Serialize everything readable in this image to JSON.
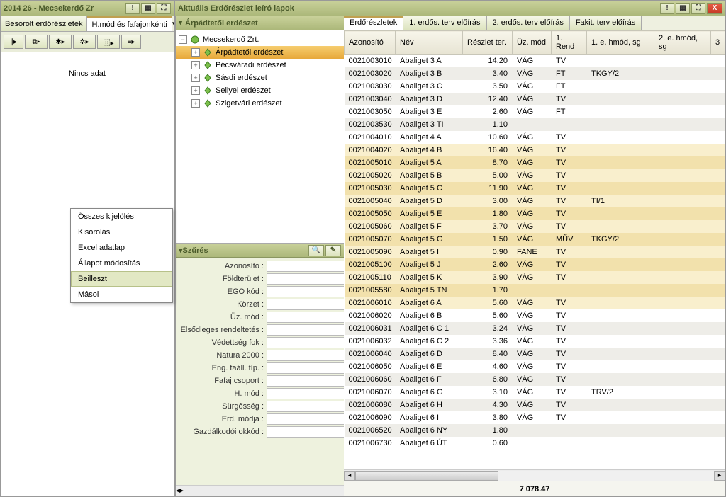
{
  "left": {
    "title": "2014 26 - Mecsekerdő Zr",
    "tabs": [
      "Besorolt erdőrészletek",
      "H.mód és fafajonkénti"
    ],
    "empty_text": "Nincs adat",
    "context_menu": [
      "Összes kijelölés",
      "Kisorolás",
      "Excel adatlap",
      "Állapot módosítás",
      "Beilleszt",
      "Másol"
    ],
    "context_selected": 4
  },
  "mid": {
    "tree_header": "Árpádtetői erdészet",
    "tree_root": "Mecsekerdő Zrt.",
    "tree_children": [
      "Árpádtetői erdészet",
      "Pécsváradi erdészet",
      "Sásdi erdészet",
      "Sellyei erdészet",
      "Szigetvári erdészet"
    ],
    "tree_selected": 0,
    "filter_title": "Szűrés",
    "filter_fields": [
      "Azonosító :",
      "Földterület :",
      "EGO kód :",
      "Körzet :",
      "Üz. mód :",
      "Elsődleges rendeltetés :",
      "Védettség fok :",
      "Natura 2000 :",
      "Eng. faáll. típ. :",
      "Fafaj csoport :",
      "H. mód :",
      "Sürgősség :",
      "Erd. módja :",
      "Gazdálkodói okkód :"
    ]
  },
  "right": {
    "title": "Aktuális Erdőrészlet leíró lapok",
    "tabs": [
      "Erdőrészletek",
      "1. erdős. terv előírás",
      "2. erdős. terv előírás",
      "Fakit. terv előírás"
    ],
    "columns": [
      "Azonosító",
      "Név",
      "Részlet ter.",
      "Üz. mód",
      "1. Rend",
      "1. e. hmód, sg",
      "2. e. hmód, sg",
      "3"
    ],
    "rows": [
      {
        "az": "0021003010",
        "nev": "Abaliget 3 A",
        "ter": "14.20",
        "uz": "VÁG",
        "rend": "TV",
        "h1": "",
        "bg": "white"
      },
      {
        "az": "0021003020",
        "nev": "Abaliget 3 B",
        "ter": "3.40",
        "uz": "VÁG",
        "rend": "FT",
        "h1": "TKGY/2",
        "bg": "gray"
      },
      {
        "az": "0021003030",
        "nev": "Abaliget 3 C",
        "ter": "3.50",
        "uz": "VÁG",
        "rend": "FT",
        "h1": "",
        "bg": "white"
      },
      {
        "az": "0021003040",
        "nev": "Abaliget 3 D",
        "ter": "12.40",
        "uz": "VÁG",
        "rend": "TV",
        "h1": "",
        "bg": "gray"
      },
      {
        "az": "0021003050",
        "nev": "Abaliget 3 E",
        "ter": "2.60",
        "uz": "VÁG",
        "rend": "FT",
        "h1": "",
        "bg": "white"
      },
      {
        "az": "0021003530",
        "nev": "Abaliget 3 TI",
        "ter": "1.10",
        "uz": "",
        "rend": "",
        "h1": "",
        "bg": "gray"
      },
      {
        "az": "0021004010",
        "nev": "Abaliget 4 A",
        "ter": "10.60",
        "uz": "VÁG",
        "rend": "TV",
        "h1": "",
        "bg": "white"
      },
      {
        "az": "0021004020",
        "nev": "Abaliget 4 B",
        "ter": "16.40",
        "uz": "VÁG",
        "rend": "TV",
        "h1": "",
        "bg": "y1"
      },
      {
        "az": "0021005010",
        "nev": "Abaliget 5 A",
        "ter": "8.70",
        "uz": "VÁG",
        "rend": "TV",
        "h1": "",
        "bg": "y2"
      },
      {
        "az": "0021005020",
        "nev": "Abaliget 5 B",
        "ter": "5.00",
        "uz": "VÁG",
        "rend": "TV",
        "h1": "",
        "bg": "y1"
      },
      {
        "az": "0021005030",
        "nev": "Abaliget 5 C",
        "ter": "11.90",
        "uz": "VÁG",
        "rend": "TV",
        "h1": "",
        "bg": "y2"
      },
      {
        "az": "0021005040",
        "nev": "Abaliget 5 D",
        "ter": "3.00",
        "uz": "VÁG",
        "rend": "TV",
        "h1": "TI/1",
        "bg": "y1"
      },
      {
        "az": "0021005050",
        "nev": "Abaliget 5 E",
        "ter": "1.80",
        "uz": "VÁG",
        "rend": "TV",
        "h1": "",
        "bg": "y2"
      },
      {
        "az": "0021005060",
        "nev": "Abaliget 5 F",
        "ter": "3.70",
        "uz": "VÁG",
        "rend": "TV",
        "h1": "",
        "bg": "y1"
      },
      {
        "az": "0021005070",
        "nev": "Abaliget 5 G",
        "ter": "1.50",
        "uz": "VÁG",
        "rend": "MŰV",
        "h1": "TKGY/2",
        "bg": "y2"
      },
      {
        "az": "0021005090",
        "nev": "Abaliget 5 I",
        "ter": "0.90",
        "uz": "FANE",
        "rend": "TV",
        "h1": "",
        "bg": "y1"
      },
      {
        "az": "0021005100",
        "nev": "Abaliget 5 J",
        "ter": "2.60",
        "uz": "VÁG",
        "rend": "TV",
        "h1": "",
        "bg": "y2"
      },
      {
        "az": "0021005110",
        "nev": "Abaliget 5 K",
        "ter": "3.90",
        "uz": "VÁG",
        "rend": "TV",
        "h1": "",
        "bg": "y1"
      },
      {
        "az": "0021005580",
        "nev": "Abaliget 5 TN",
        "ter": "1.70",
        "uz": "",
        "rend": "",
        "h1": "",
        "bg": "y2"
      },
      {
        "az": "0021006010",
        "nev": "Abaliget 6 A",
        "ter": "5.60",
        "uz": "VÁG",
        "rend": "TV",
        "h1": "",
        "bg": "y1"
      },
      {
        "az": "0021006020",
        "nev": "Abaliget 6 B",
        "ter": "5.60",
        "uz": "VÁG",
        "rend": "TV",
        "h1": "",
        "bg": "white"
      },
      {
        "az": "0021006031",
        "nev": "Abaliget 6 C 1",
        "ter": "3.24",
        "uz": "VÁG",
        "rend": "TV",
        "h1": "",
        "bg": "gray"
      },
      {
        "az": "0021006032",
        "nev": "Abaliget 6 C 2",
        "ter": "3.36",
        "uz": "VÁG",
        "rend": "TV",
        "h1": "",
        "bg": "white"
      },
      {
        "az": "0021006040",
        "nev": "Abaliget 6 D",
        "ter": "8.40",
        "uz": "VÁG",
        "rend": "TV",
        "h1": "",
        "bg": "gray"
      },
      {
        "az": "0021006050",
        "nev": "Abaliget 6 E",
        "ter": "4.60",
        "uz": "VÁG",
        "rend": "TV",
        "h1": "",
        "bg": "white"
      },
      {
        "az": "0021006060",
        "nev": "Abaliget 6 F",
        "ter": "6.80",
        "uz": "VÁG",
        "rend": "TV",
        "h1": "",
        "bg": "gray"
      },
      {
        "az": "0021006070",
        "nev": "Abaliget 6 G",
        "ter": "3.10",
        "uz": "VÁG",
        "rend": "TV",
        "h1": "TRV/2",
        "bg": "white"
      },
      {
        "az": "0021006080",
        "nev": "Abaliget 6 H",
        "ter": "4.30",
        "uz": "VÁG",
        "rend": "TV",
        "h1": "",
        "bg": "gray"
      },
      {
        "az": "0021006090",
        "nev": "Abaliget 6 I",
        "ter": "3.80",
        "uz": "VÁG",
        "rend": "TV",
        "h1": "",
        "bg": "white"
      },
      {
        "az": "0021006520",
        "nev": "Abaliget 6 NY",
        "ter": "1.80",
        "uz": "",
        "rend": "",
        "h1": "",
        "bg": "gray"
      },
      {
        "az": "0021006730",
        "nev": "Abaliget 6 ÚT",
        "ter": "0.60",
        "uz": "",
        "rend": "",
        "h1": "",
        "bg": "white"
      }
    ],
    "footer_total": "7 078.47"
  }
}
